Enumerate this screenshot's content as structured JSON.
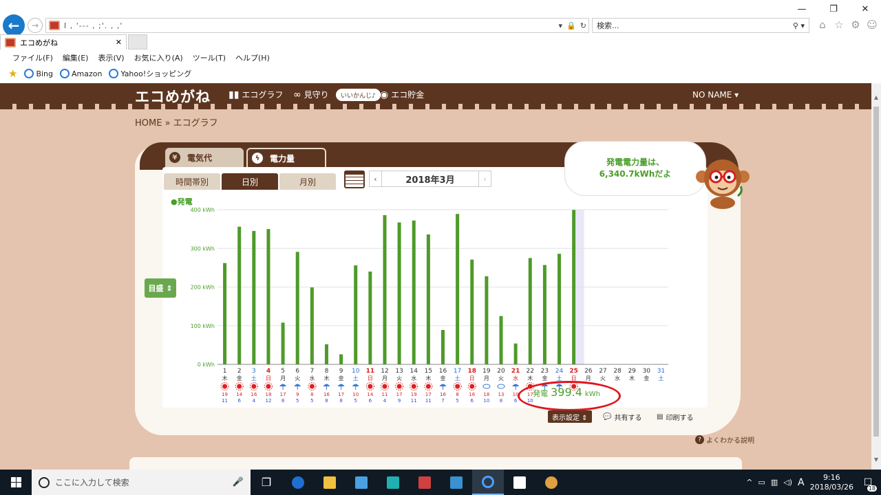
{
  "browser": {
    "address_url": "I ,   '---         ,  ;'.   ,  ,'",
    "search_placeholder": "検索...",
    "tab_title": "エコめがね",
    "menu": [
      "ファイル(F)",
      "編集(E)",
      "表示(V)",
      "お気に入り(A)",
      "ツール(T)",
      "ヘルプ(H)"
    ],
    "favorites": [
      "Bing",
      "Amazon",
      "Yahoo!ショッピング"
    ]
  },
  "site": {
    "logo": "エコめがね",
    "nav": [
      "エコグラフ",
      "見守り",
      "エコ貯金"
    ],
    "nav_badge": "いいかんじ♪",
    "user_menu": "NO NAME ▾",
    "breadcrumb": "HOME » エコグラフ"
  },
  "tabs": {
    "main": [
      "電気代",
      "電力量"
    ],
    "active_main": "電力量",
    "sub": [
      "時間帯別",
      "日別",
      "月別"
    ],
    "active_sub": "日別"
  },
  "date_selector": {
    "label": "2018年3月"
  },
  "bubble": {
    "line1": "発電電力量は、",
    "line2": "6,340.7kWhだよ"
  },
  "legend": "●発電",
  "scale_button": "目盛 ⇕",
  "chart_data": {
    "type": "bar",
    "series_name": "発電",
    "ylabel": "",
    "y_unit": "kWh",
    "ylim": [
      0,
      400
    ],
    "yticks": [
      "0 kWh",
      "100 kWh",
      "200 kWh",
      "300 kWh",
      "400 kWh"
    ],
    "categories": [
      "1",
      "2",
      "3",
      "4",
      "5",
      "6",
      "7",
      "8",
      "9",
      "10",
      "11",
      "12",
      "13",
      "14",
      "15",
      "16",
      "17",
      "18",
      "19",
      "20",
      "21",
      "22",
      "23",
      "24",
      "25",
      "26",
      "27",
      "28",
      "29",
      "30",
      "31"
    ],
    "weekdays": [
      "木",
      "金",
      "土",
      "日",
      "月",
      "火",
      "水",
      "木",
      "金",
      "土",
      "日",
      "月",
      "火",
      "水",
      "木",
      "金",
      "土",
      "日",
      "月",
      "火",
      "水",
      "木",
      "金",
      "土",
      "日",
      "月",
      "火",
      "水",
      "木",
      "金",
      "土"
    ],
    "values": [
      262,
      356,
      345,
      350,
      108,
      291,
      199,
      52,
      26,
      256,
      240,
      386,
      367,
      372,
      336,
      89,
      389,
      271,
      228,
      125,
      54,
      275,
      257,
      286,
      399.4,
      null,
      null,
      null,
      null,
      null,
      null
    ],
    "weather": [
      "sun",
      "sun",
      "sun",
      "sun",
      "rain",
      "rain",
      "sun",
      "rain",
      "rain",
      "rain",
      "sun",
      "sun",
      "sun",
      "sun",
      "sun",
      "rain",
      "sun",
      "sun",
      "cloud",
      "cloud",
      "rain",
      "sun",
      "rain",
      "rain",
      "sun",
      "",
      "",
      "",
      "",
      "",
      ""
    ],
    "temp_high": [
      "19",
      "14",
      "16",
      "18",
      "17",
      "9",
      "8",
      "16",
      "17",
      "10",
      "14",
      "11",
      "17",
      "19",
      "17",
      "16",
      "8",
      "16",
      "18",
      "13",
      "10",
      "17",
      "",
      "",
      "",
      "",
      "",
      "",
      "",
      "",
      ""
    ],
    "temp_low": [
      "11",
      "6",
      "4",
      "12",
      "8",
      "5",
      "5",
      "8",
      "8",
      "5",
      "6",
      "4",
      "9",
      "11",
      "11",
      "7",
      "5",
      "6",
      "10",
      "8",
      "6",
      "10",
      "",
      "",
      "",
      "",
      "",
      "",
      "",
      "",
      ""
    ],
    "grid": true,
    "highlight_day": "25"
  },
  "generation_today": {
    "label": "発電",
    "value": "399.4",
    "unit": "kWh"
  },
  "actions": {
    "display": "表示設定 ⇕",
    "share": "共有する",
    "print": "印刷する"
  },
  "help": "よくわかる説明",
  "taskbar": {
    "search_placeholder": "ここに入力して検索",
    "ime": "A",
    "time": "9:16",
    "date": "2018/03/26",
    "notifications": "18"
  }
}
